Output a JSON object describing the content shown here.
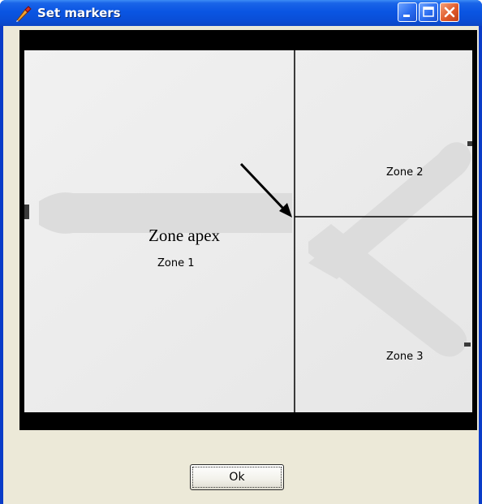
{
  "window": {
    "title": "Set markers",
    "controls": [
      "minimize-icon",
      "maximize-icon",
      "close-icon"
    ]
  },
  "image": {
    "annotation": "Zone apex",
    "zones": [
      "Zone 1",
      "Zone 2",
      "Zone 3"
    ]
  },
  "footer": {
    "ok_label": "Ok"
  },
  "colors": {
    "titlebar": "#0a55e2",
    "client_background": "#ece9d8",
    "close_button": "#e05a2a",
    "marker_lines": "#000000"
  }
}
